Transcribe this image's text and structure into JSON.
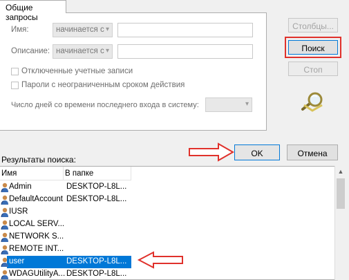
{
  "tab": {
    "label": "Общие запросы"
  },
  "query": {
    "name_label": "Имя:",
    "name_op": "начинается с",
    "name_value": "",
    "desc_label": "Описание:",
    "desc_op": "начинается с",
    "desc_value": "",
    "disabled_accounts_label": "Отключенные учетные записи",
    "no_expire_label": "Пароли с неограниченным сроком действия",
    "days_label": "Число дней со времени последнего входа в систему:",
    "days_value": ""
  },
  "buttons": {
    "columns": "Столбцы...",
    "search": "Поиск",
    "stop": "Стоп",
    "ok": "OK",
    "cancel": "Отмена"
  },
  "results": {
    "label": "Результаты поиска:",
    "columns": [
      "Имя",
      "В папке"
    ],
    "rows": [
      {
        "name": "Admin",
        "folder": "DESKTOP-L8L..."
      },
      {
        "name": "DefaultAccount",
        "folder": "DESKTOP-L8L..."
      },
      {
        "name": "IUSR",
        "folder": ""
      },
      {
        "name": "LOCAL SERV...",
        "folder": ""
      },
      {
        "name": "NETWORK S...",
        "folder": ""
      },
      {
        "name": "REMOTE INT...",
        "folder": ""
      },
      {
        "name": "user",
        "folder": "DESKTOP-L8L..."
      },
      {
        "name": "WDAGUtilityA...",
        "folder": "DESKTOP-L8L..."
      }
    ],
    "selected_index": 6
  },
  "colors": {
    "selection": "#0078d7",
    "annotation": "#e0312b"
  }
}
